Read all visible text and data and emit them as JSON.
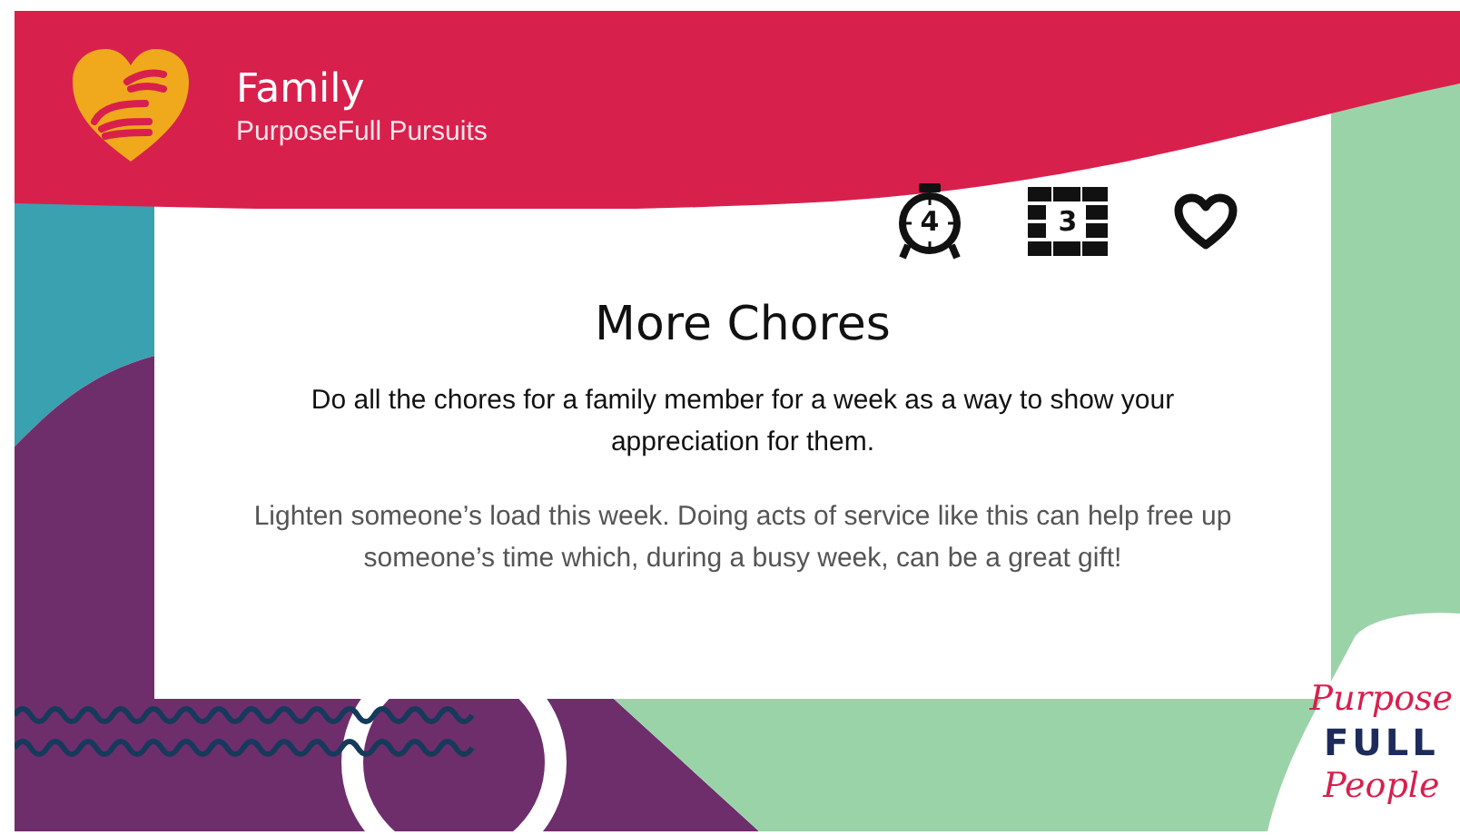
{
  "header": {
    "title": "Family",
    "subtitle": "PurposeFull Pursuits"
  },
  "card": {
    "stats": [
      {
        "kind": "timer",
        "value": "4"
      },
      {
        "kind": "bricks",
        "value": "3"
      },
      {
        "kind": "heart"
      }
    ],
    "title": "More Chores",
    "summary": "Do all the chores for a family member for a week as a way to show your appreciation for them.",
    "description": "Lighten someone’s load this week. Doing acts of service like this can help free up someone’s time which, during a busy week, can be a great gift!"
  },
  "brand_logo": [
    "Purpose",
    "FULL",
    "People"
  ]
}
